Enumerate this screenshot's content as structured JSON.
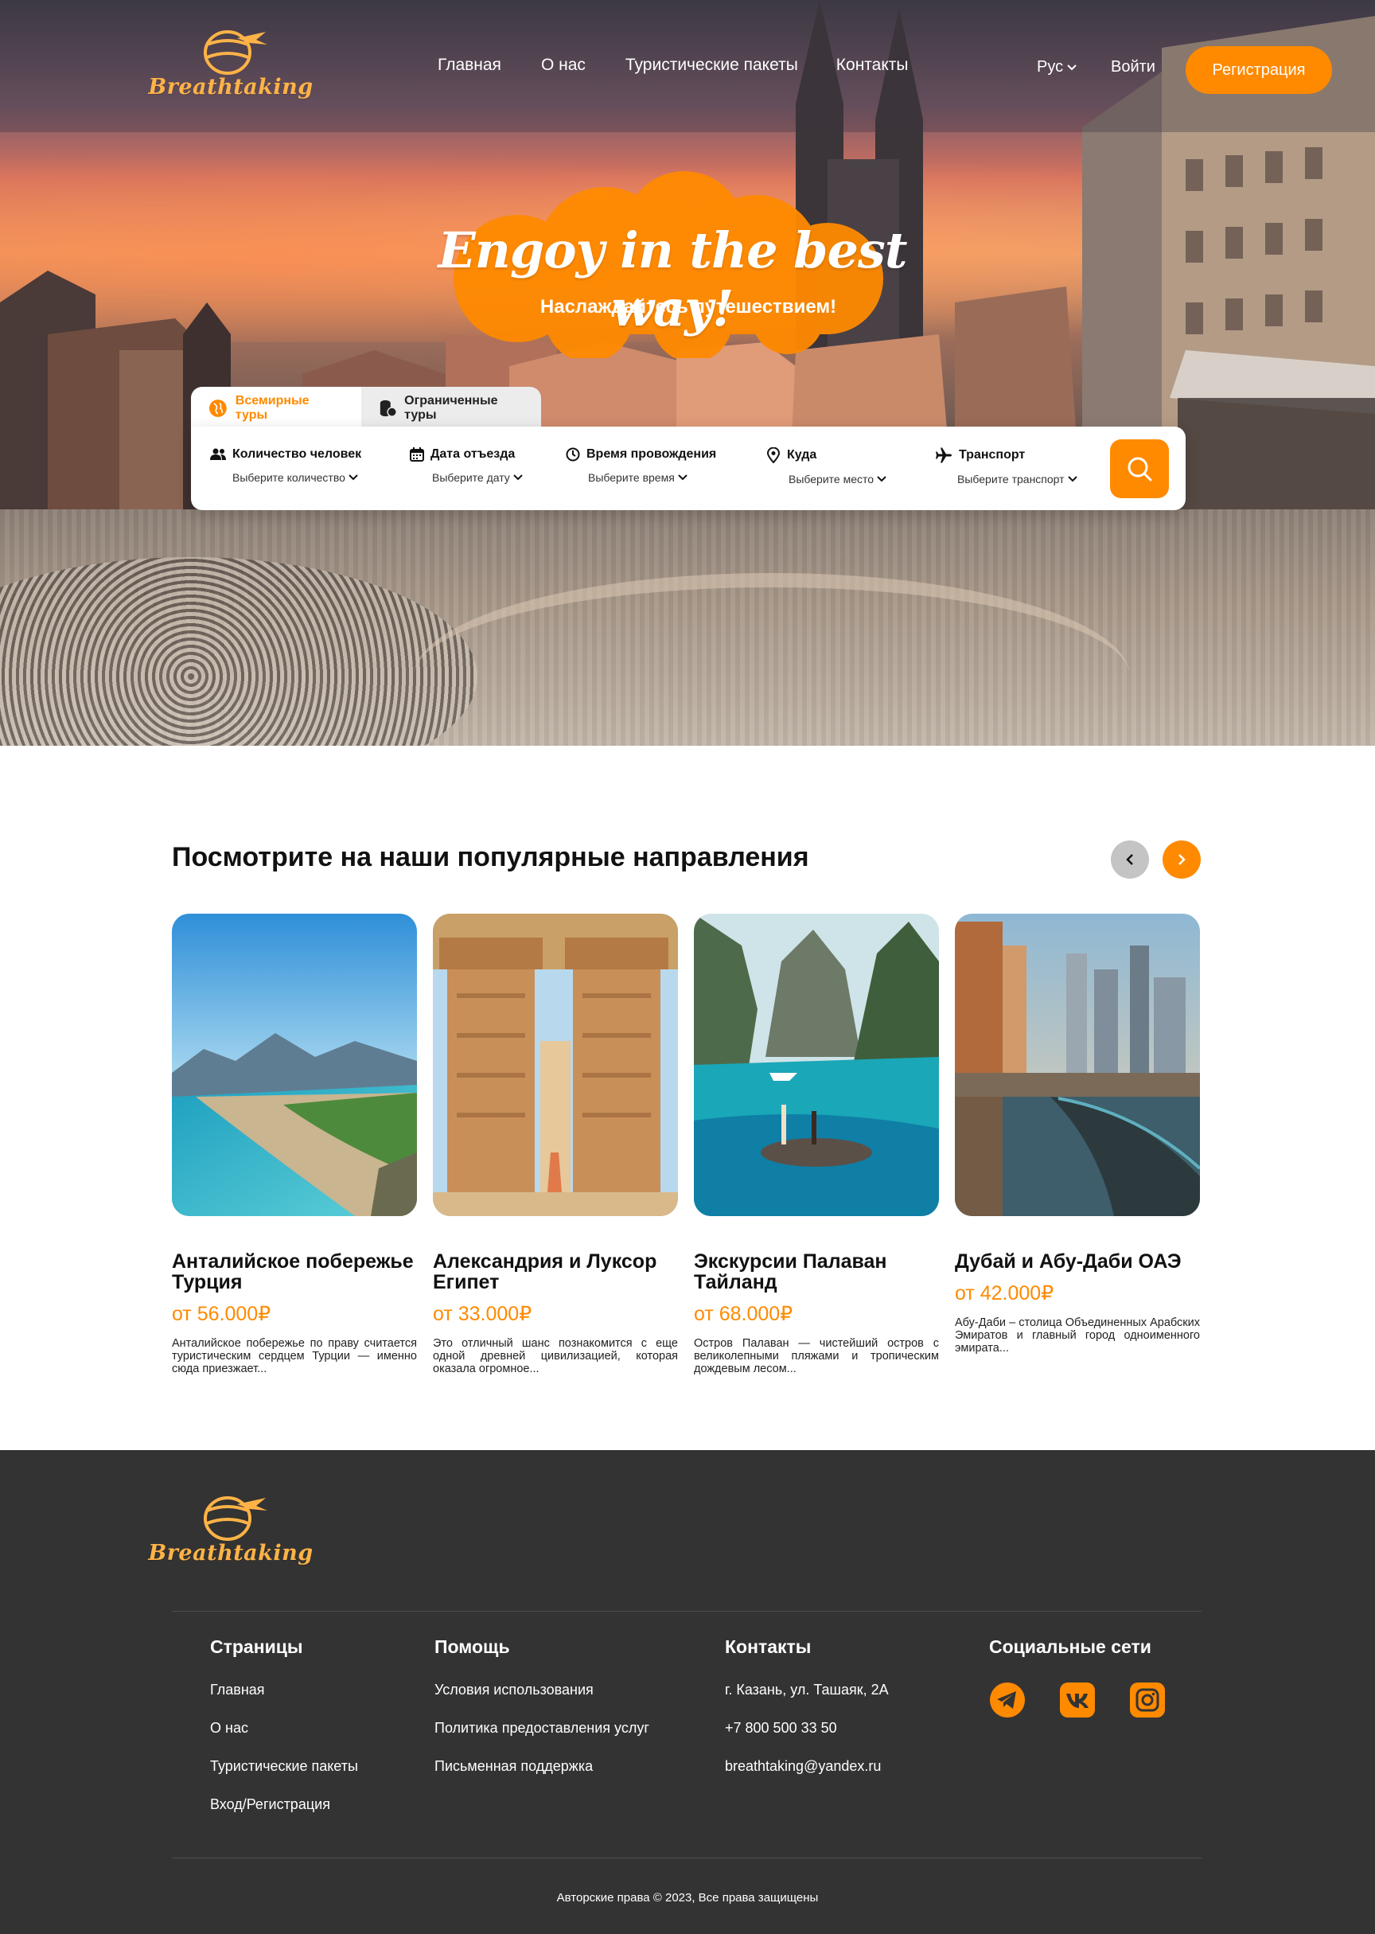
{
  "brand": {
    "name": "Breathtaking",
    "accent": "#ff8a00",
    "logo_color": "#ffb347"
  },
  "nav": {
    "items": [
      "Главная",
      "О нас",
      "Туристические пакеты",
      "Контакты"
    ],
    "language": "Рус",
    "login": "Войти",
    "register": "Регистрация"
  },
  "hero": {
    "slogan": "Engoy in the best way!",
    "subtitle": "Наслаждайтесь путешествием!"
  },
  "search": {
    "tabs": [
      {
        "label": "Всемирные туры",
        "icon": "globe-icon",
        "active": true
      },
      {
        "label": "Ограниченные туры",
        "icon": "coins-icon",
        "active": false
      }
    ],
    "fields": [
      {
        "label": "Количество человек",
        "value": "Выберите количество",
        "icon": "people-icon"
      },
      {
        "label": "Дата отъезда",
        "value": "Выберите дату",
        "icon": "calendar-icon"
      },
      {
        "label": "Время провождения",
        "value": "Выберите время",
        "icon": "clock-icon"
      },
      {
        "label": "Куда",
        "value": "Выберите место",
        "icon": "location-pin-icon"
      },
      {
        "label": "Транспорт",
        "value": "Выберите транспорт",
        "icon": "airplane-icon"
      }
    ],
    "button_icon": "search-icon"
  },
  "destinations": {
    "title": "Посмотрите на наши популярные направления",
    "cards": [
      {
        "title": "Анталийское побережье Турция",
        "price": "от 56.000₽",
        "desc": "Анталийское побережье по праву считается туристическим сердцем Турции — именно сюда приезжает..."
      },
      {
        "title": "Александрия и Луксор Египет",
        "price": "от 33.000₽",
        "desc": "Это отличный шанс познакомится с еще одной древней цивилизацией, которая оказала огромное..."
      },
      {
        "title": "Экскурсии Палаван Тайланд",
        "price": "от 68.000₽",
        "desc": "Остров Палаван — чистейший остров с великолепными пляжами и тропическим дождевым лесом..."
      },
      {
        "title": "Дубай и Абу-Даби ОАЭ",
        "price": "от 42.000₽",
        "desc": "Абу-Даби – столица Объединенных Арабских Эмиратов и главный город одноименного эмирата..."
      }
    ]
  },
  "footer": {
    "columns": [
      {
        "title": "Страницы",
        "links": [
          "Главная",
          "О нас",
          "Туристические пакеты",
          "Вход/Регистрация"
        ]
      },
      {
        "title": "Помощь",
        "links": [
          "Условия использования",
          "Политика предоставления услуг",
          "Письменная поддержка"
        ]
      },
      {
        "title": "Контакты",
        "links": [
          "г. Казань, ул. Ташаяк, 2А",
          "+7 800 500 33 50",
          "breathtaking@yandex.ru"
        ]
      }
    ],
    "social_title": "Социальные сети",
    "social": [
      "telegram-icon",
      "vk-icon",
      "instagram-icon"
    ],
    "copyright": "Авторские права © 2023, Все права защищены"
  }
}
